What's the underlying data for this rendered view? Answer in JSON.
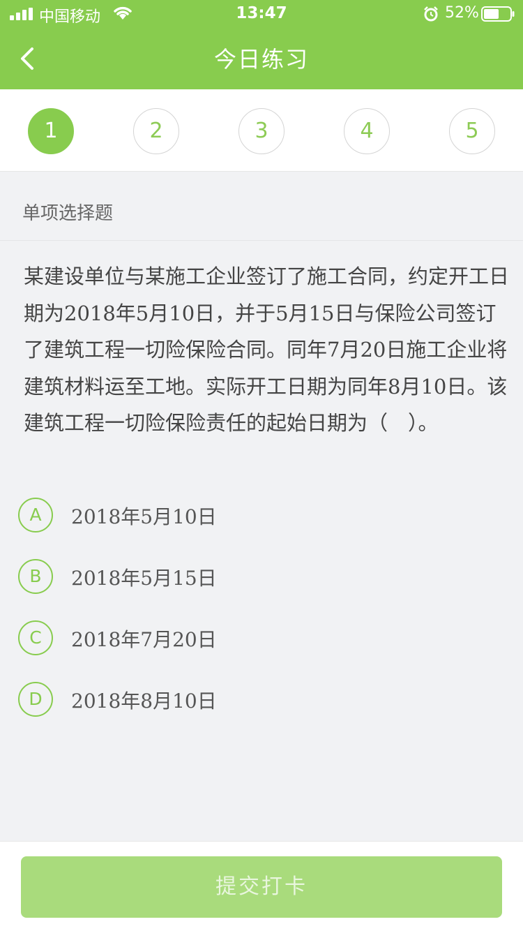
{
  "status_bar": {
    "carrier": "中国移动",
    "time": "13:47",
    "battery": "52%",
    "icons": [
      "signal-icon",
      "wifi-icon",
      "alarm-icon",
      "battery-icon"
    ]
  },
  "header": {
    "title": "今日练习",
    "back_icon": "chevron-left-icon",
    "bg_color": "#88cc4e"
  },
  "steps": {
    "items": [
      "1",
      "2",
      "3",
      "4",
      "5"
    ],
    "active_index": 0,
    "accent_color": "#88cc4e"
  },
  "question": {
    "type": "单项选择题",
    "text": "某建设单位与某施工企业签订了施工合同，约定开工日期为2018年5月10日，并于5月15日与保险公司签订了建筑工程一切险保险合同。同年7月20日施工企业将建筑材料运至工地。实际开工日期为同年8月10日。该建筑工程一切险保险责任的起始日期为（　）。",
    "options": [
      {
        "letter": "A",
        "text": "2018年5月10日"
      },
      {
        "letter": "B",
        "text": "2018年5月15日"
      },
      {
        "letter": "C",
        "text": "2018年7月20日"
      },
      {
        "letter": "D",
        "text": "2018年8月10日"
      }
    ]
  },
  "footer": {
    "submit_label": "提交打卡",
    "button_color": "#a9db7c"
  }
}
